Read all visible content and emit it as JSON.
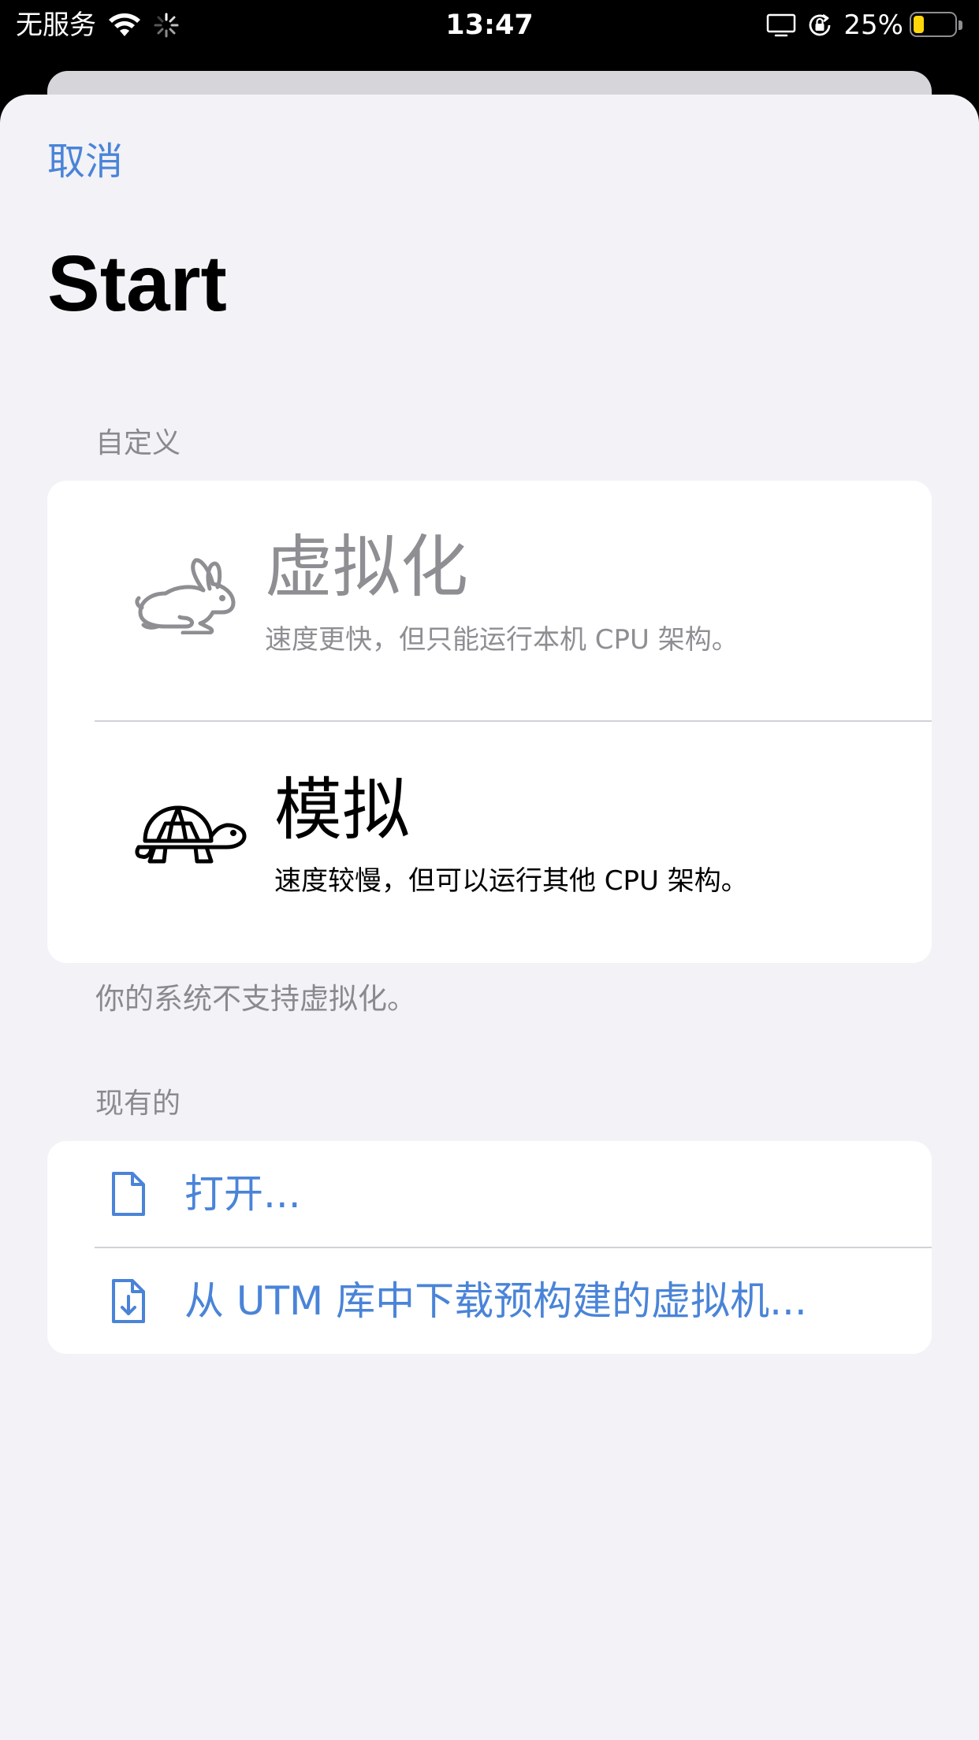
{
  "status_bar": {
    "carrier": "无服务",
    "time": "13:47",
    "battery_percent_label": "25%",
    "battery_level": 0.25,
    "battery_color": "#ffd60a",
    "icons": [
      "wifi-icon",
      "activity-spinner-icon",
      "screen-mirroring-icon",
      "orientation-lock-icon",
      "battery-icon"
    ]
  },
  "nav": {
    "cancel_label": "取消"
  },
  "page": {
    "title": "Start"
  },
  "custom_section": {
    "header": "自定义",
    "options": [
      {
        "title": "虚拟化",
        "description": "速度更快，但只能运行本机 CPU 架构。",
        "icon": "hare-icon",
        "enabled": false
      },
      {
        "title": "模拟",
        "description": "速度较慢，但可以运行其他 CPU 架构。",
        "icon": "tortoise-icon",
        "enabled": true
      }
    ],
    "footer": "你的系统不支持虚拟化。"
  },
  "existing_section": {
    "header": "现有的",
    "items": [
      {
        "label": "打开...",
        "icon": "document-icon"
      },
      {
        "label": "从 UTM 库中下载预构建的虚拟机...",
        "icon": "document-download-icon"
      }
    ]
  },
  "colors": {
    "accent": "#4a84d8",
    "background": "#f2f2f7",
    "disabled_text": "#8e8e93"
  }
}
